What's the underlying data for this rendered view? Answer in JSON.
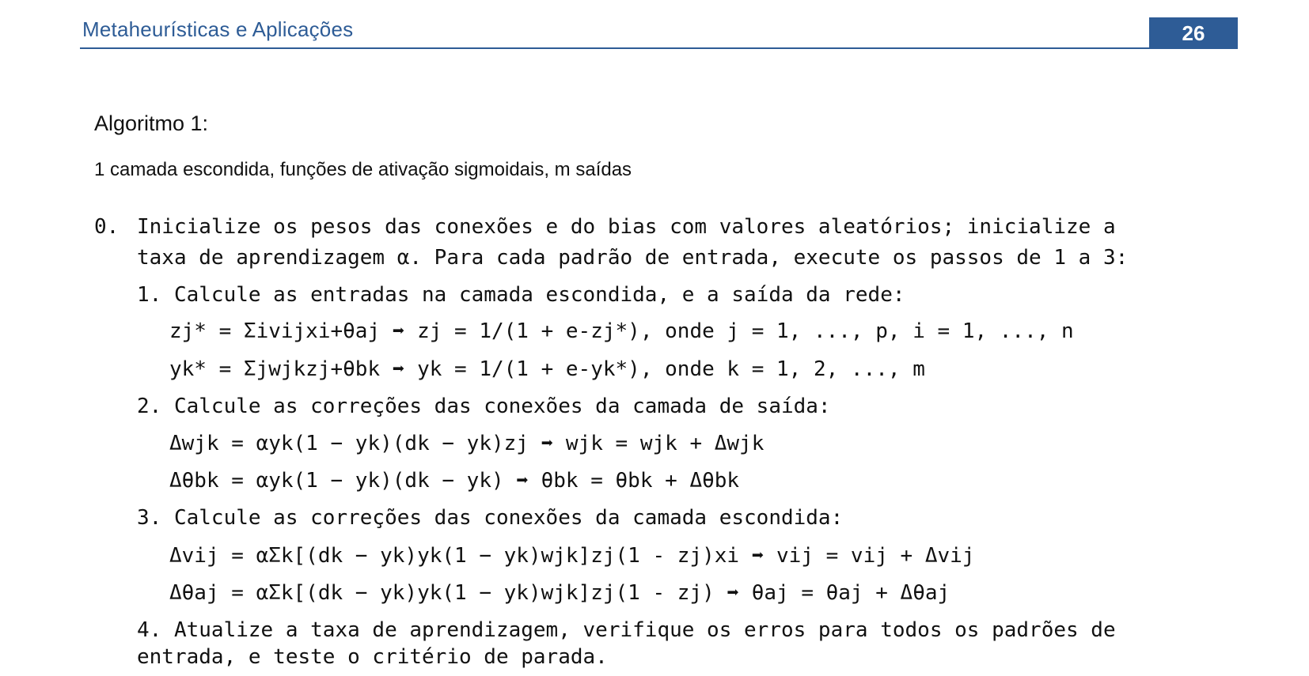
{
  "header": {
    "title": "Metaheurísticas e Aplicações",
    "page_number": "26"
  },
  "algorithm": {
    "title": "Algoritmo 1:",
    "subtitle": "1 camada escondida, funções de ativação sigmoidais, m saídas"
  },
  "steps": {
    "step0": {
      "marker": "0.",
      "line1": "Inicialize os pesos das conexões e do bias com valores aleatórios; inicialize a",
      "line2": "taxa de aprendizagem α. Para cada padrão de entrada, execute os passos de 1 a 3:"
    },
    "step1": "1. Calcule as entradas na camada escondida, e a saída da rede:",
    "step1_equations": [
      "zj* = Σivijxi+θaj ➡ zj = 1/(1 + e-zj*), onde j = 1, ..., p, i = 1, ..., n",
      "yk* = Σjwjkzj+θbk ➡ yk = 1/(1 + e-yk*), onde k = 1, 2, ..., m"
    ],
    "step2": "2. Calcule as correções das conexões da camada de saída:",
    "step2_equations": [
      "Δwjk = αyk(1 − yk)(dk − yk)zj ➡ wjk = wjk + Δwjk",
      "Δθbk = αyk(1 − yk)(dk − yk) ➡ θbk = θbk + Δθbk"
    ],
    "step3": "3. Calcule as correções das conexões da camada escondida:",
    "step3_equations": [
      "Δvij = αΣk[(dk − yk)yk(1 − yk)wjk]zj(1 - zj)xi ➡ vij = vij + Δvij",
      "Δθaj = αΣk[(dk − yk)yk(1 − yk)wjk]zj(1 - zj) ➡ θaj = θaj + Δθaj"
    ],
    "step4": {
      "line1": "4. Atualize a taxa de aprendizagem, verifique os erros para todos os padrões de",
      "line2": "entrada, e teste o critério de parada."
    }
  },
  "colors": {
    "accent": "#2e5c96",
    "text": "#111111"
  },
  "icons": {
    "implication_arrow": "right-arrow-icon"
  }
}
